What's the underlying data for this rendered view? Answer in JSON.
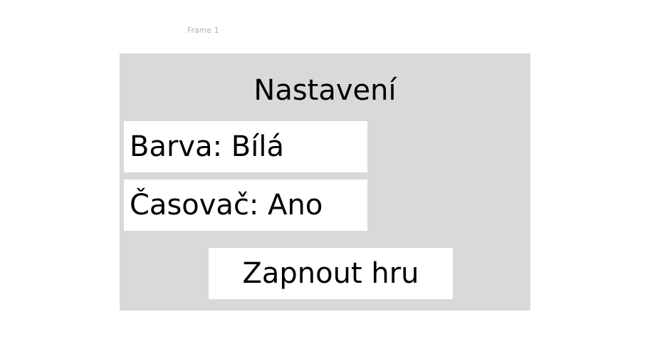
{
  "frame": {
    "label": "Frame 1"
  },
  "settings": {
    "title": "Nastavení",
    "color_option": "Barva: Bílá",
    "timer_option": "Časovač: Ano",
    "start_button_label": "Zapnout hru"
  },
  "colors": {
    "canvas_background": "#ffffff",
    "frame_background": "#d9d9d9",
    "box_background": "#ffffff",
    "text": "#000000",
    "frame_label": "#b3b3b3"
  }
}
